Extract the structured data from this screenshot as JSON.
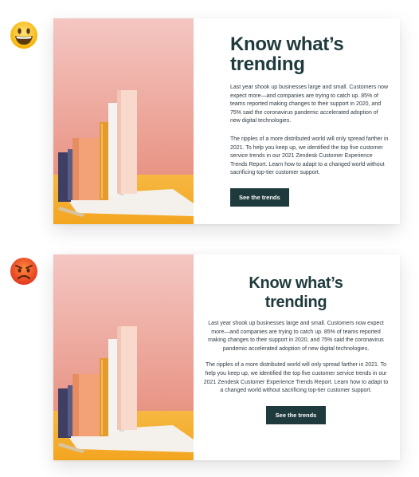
{
  "emojis": [
    {
      "name": "grinning-face-icon",
      "meaning": "good"
    },
    {
      "name": "angry-face-icon",
      "meaning": "bad"
    }
  ],
  "cards": [
    {
      "alignment": "left",
      "title_line1": "Know what’s",
      "title_line2": "trending",
      "paragraph1": "Last year shook up businesses large and small. Customers now expect more—and companies are trying to catch up. 85% of teams reported making changes to their support in 2020, and 75% said the coronavirus pandemic accelerated adoption of new digital technologies.",
      "paragraph2": "The ripples of a more distributed world will only spread farther in 2021. To help you keep up, we identified the top five customer service trends in our 2021 Zendesk Customer Experience Trends Report. Learn how to adapt to a changed world without sacrificing top-tier customer support.",
      "button_label": "See the trends"
    },
    {
      "alignment": "center",
      "title_line1": "Know what’s",
      "title_line2": "trending",
      "paragraph1": "Last year shook up businesses large and small. Customers now expect more—and companies are trying to catch up. 85% of teams reported making changes to their support in 2020, and 75% said the coronavirus pandemic accelerated adoption of new digital technologies.",
      "paragraph2": "The ripples of a more distributed world will only spread farther in 2021. To help you keep up, we identified the top five customer service trends in our 2021 Zendesk Customer Experience Trends Report. Learn how to adapt to a changed world without sacrificing top-tier customer support.",
      "button_label": "See the trends"
    }
  ],
  "colors": {
    "title": "#1f3a3d",
    "button_bg": "#1f3a3d",
    "button_text": "#ffffff",
    "body_text": "#2f3941"
  }
}
